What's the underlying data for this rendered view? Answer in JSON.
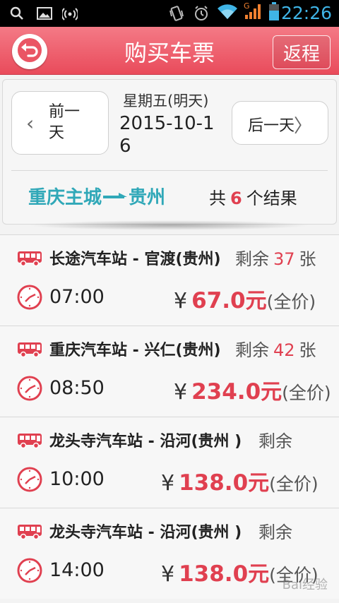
{
  "status_bar": {
    "time": "22:26",
    "network": "G",
    "icons": [
      "search-icon",
      "image-icon",
      "wifi-hotspot-icon",
      "vibrate-icon",
      "alarm-icon",
      "wifi-icon",
      "signal-icon",
      "battery-icon"
    ],
    "time_color": "#3fb4e6"
  },
  "header": {
    "title": "购买车票",
    "return_label": "返程",
    "back_icon": "back-arrow-icon",
    "color": "#e94b5b"
  },
  "date_nav": {
    "prev_label": "前一天",
    "next_label": "后一天",
    "weekday": "星期五(明天)",
    "date": "2015-10-16"
  },
  "route": {
    "from": "重庆主城",
    "to": "贵州",
    "result_prefix": "共",
    "result_count": "6",
    "result_suffix": "个结果"
  },
  "tickets": [
    {
      "station": "长途汽车站 - 官渡(贵州)",
      "remain_label": "剩余",
      "remain_count": "37",
      "remain_unit": "张",
      "time": "07:00",
      "currency": "¥",
      "price": "67.0",
      "unit": "元",
      "price_note": "(全价)"
    },
    {
      "station": "重庆汽车站 - 兴仁(贵州)",
      "remain_label": "剩余",
      "remain_count": "42",
      "remain_unit": "张",
      "time": "08:50",
      "currency": "¥",
      "price": "234.0",
      "unit": "元",
      "price_note": "(全价)"
    },
    {
      "station": "龙头寺汽车站 - 沿河(贵州 )",
      "remain_label": "剩余",
      "remain_count": "",
      "remain_unit": "",
      "time": "10:00",
      "currency": "¥",
      "price": "138.0",
      "unit": "元",
      "price_note": "(全价)"
    },
    {
      "station": "龙头寺汽车站 - 沿河(贵州 )",
      "remain_label": "剩余",
      "remain_count": "",
      "remain_unit": "",
      "time": "14:00",
      "currency": "¥",
      "price": "138.0",
      "unit": "元",
      "price_note": "(全价)"
    }
  ],
  "watermark": "Bai经验"
}
